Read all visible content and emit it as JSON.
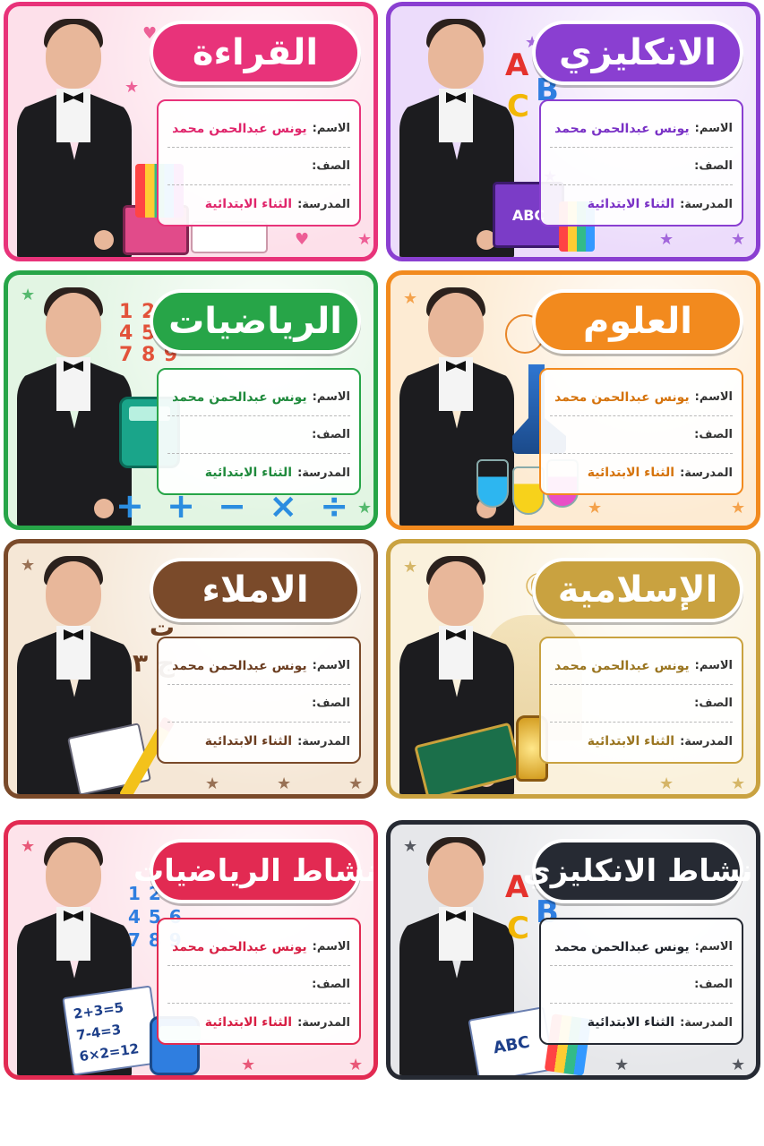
{
  "labels": [
    {
      "title": "القراءة",
      "theme": "reading",
      "accent": "#e8337a"
    },
    {
      "title": "الانكليزي",
      "theme": "english",
      "accent": "#8a3fd1",
      "book_text": "ABC",
      "letters": [
        "A",
        "B",
        "C"
      ]
    },
    {
      "title": "الرياضيات",
      "theme": "math",
      "accent": "#27a548",
      "numbers": "1 2 3 4 5 6 7 8 9",
      "symbols": "+ + − × ÷"
    },
    {
      "title": "العلوم",
      "theme": "science",
      "accent": "#f28a1e"
    },
    {
      "title": "الاملاء",
      "theme": "dictation",
      "accent": "#7a4a2a",
      "letters": "ب ت ج ٣"
    },
    {
      "title": "الإسلامية",
      "theme": "islamic",
      "accent": "#c9a240"
    },
    {
      "title": "نشاط الرياضيات",
      "theme": "math-activity",
      "accent": "#e22a52",
      "numbers": "1 2 3 4 5 6 7 8 9",
      "notebook": [
        "2+3=5",
        "7-4=3",
        "6×2=12"
      ]
    },
    {
      "title": "نشاط الانكليزي",
      "theme": "english-activity",
      "accent": "#262a33",
      "book_text": "ABC",
      "letters": [
        "A",
        "B",
        "C"
      ]
    }
  ],
  "fields": {
    "name_label": "الاسم:",
    "name_value": "يونس عبدالحمن محمد",
    "class_label": "الصف:",
    "school_label": "المدرسة:",
    "school_value": "الثناء الابتدائية"
  }
}
